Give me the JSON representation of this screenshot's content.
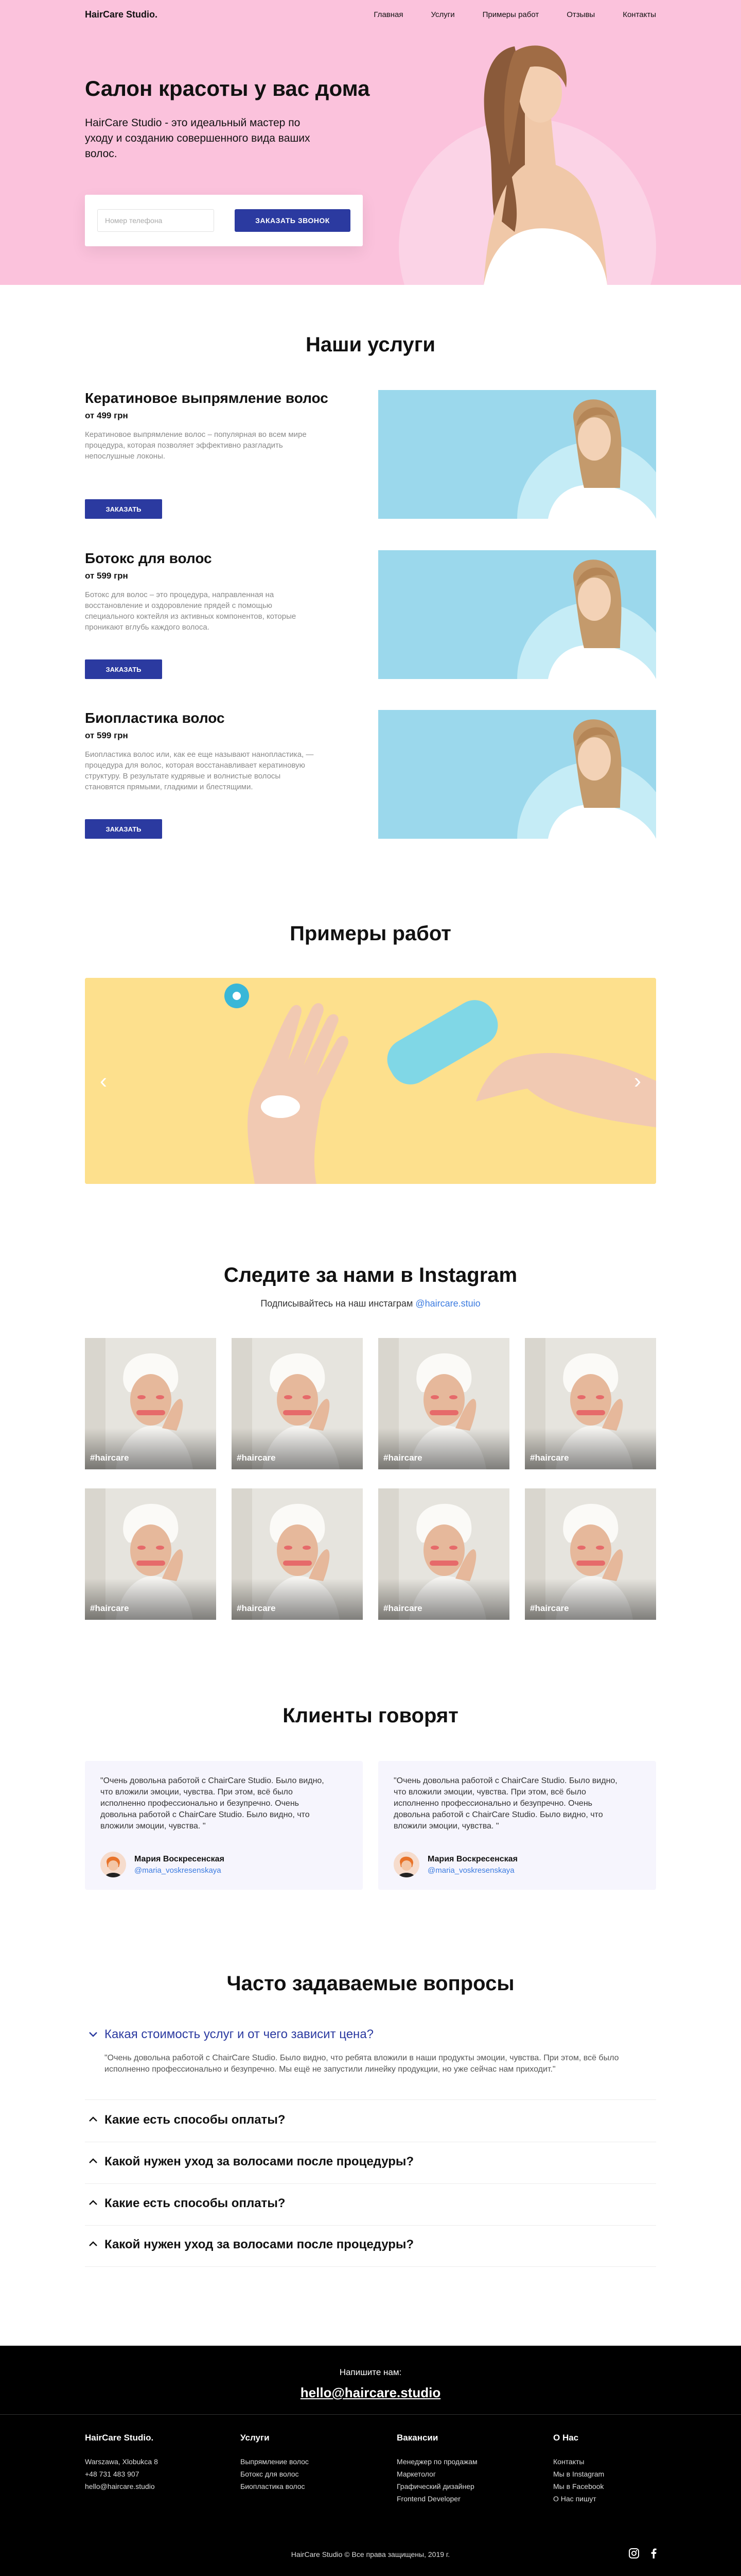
{
  "header": {
    "logo": "HairCare Studio.",
    "nav": [
      "Главная",
      "Услуги",
      "Примеры работ",
      "Отзывы",
      "Контакты"
    ]
  },
  "hero": {
    "title": "Салон красоты у вас дома",
    "subtitle": "HairCare Studio - это идеальный мастер по уходу и созданию совершенного вида ваших волос.",
    "phone_placeholder": "Номер телефона",
    "cta_label": "ЗАКАЗАТЬ ЗВОНОК"
  },
  "services": {
    "title": "Наши услуги",
    "items": [
      {
        "name": "Кератиновое выпрямление волос",
        "price": "от 499 грн",
        "desc": "Кератиновое выпрямление волос – популярная во всем мире процедура, которая позволяет эффективно разгладить непослушные локоны.",
        "button": "ЗАКАЗАТЬ"
      },
      {
        "name": "Ботокс для волос",
        "price": "от 599 грн",
        "desc": "Ботокс для волос – это процедура, направленная на восстановление и оздоровление прядей с помощью специального коктейля из активных компонентов, которые проникают вглубь каждого волоса.",
        "button": "ЗАКАЗАТЬ"
      },
      {
        "name": "Биопластика волос",
        "price": "от 599 грн",
        "desc": "Биопластика волос или, как ее еще называют нанопластика, — процедура для волос, которая восстанавливает кератиновую структуру. В результате кудрявые и волнистые волосы становятся прямыми, гладкими и блестящими.",
        "button": "ЗАКАЗАТЬ"
      }
    ]
  },
  "works": {
    "title": "Примеры работ",
    "prev_icon": "chevron-left-icon",
    "next_icon": "chevron-right-icon"
  },
  "instagram": {
    "title": "Следите за нами в Instagram",
    "subtitle": "Подписывайтесь на наш инстаграм",
    "handle": "@haircare.stuio",
    "tiles": [
      "#haircare",
      "#haircare",
      "#haircare",
      "#haircare",
      "#haircare",
      "#haircare",
      "#haircare",
      "#haircare"
    ]
  },
  "reviews": {
    "title": "Клиенты говорят",
    "items": [
      {
        "text": "\"Очень довольна работой с ChairCare Studio. Было видно, что вложили  эмоции, чувства. При этом, всё было исполненно профессионально и безупречно. Очень довольна работой с ChairCare Studio. Было видно, что вложили  эмоции, чувства. \"",
        "name": "Мария Воскресенская",
        "handle": "@maria_voskresenskaya"
      },
      {
        "text": "\"Очень довольна работой с ChairCare Studio. Было видно, что вложили  эмоции, чувства. При этом, всё было исполненно профессионально и безупречно. Очень довольна работой с ChairCare Studio. Было видно, что вложили  эмоции, чувства. \"",
        "name": "Мария Воскресенская",
        "handle": "@maria_voskresenskaya"
      }
    ]
  },
  "faq": {
    "title": "Часто задаваемые вопросы",
    "items": [
      {
        "q": "Какая стоимость услуг и от чего зависит цена?",
        "a": "\"Очень довольна работой с ChairCare Studio. Было видно, что ребята вложили в наши продукты эмоции, чувства. При этом, всё было исполненно профессионально и безупречно. Мы ещё не запустили линейку продукции, но уже сейчас нам приходит.\"",
        "open": true
      },
      {
        "q": "Какие есть способы оплаты?",
        "open": false
      },
      {
        "q": "Какой нужен уход за волосами после процедуры?",
        "open": false
      },
      {
        "q": "Какие есть способы оплаты?",
        "open": false
      },
      {
        "q": "Какой нужен уход за волосами после процедуры?",
        "open": false
      }
    ]
  },
  "footer": {
    "cta_label": "Напишите нам:",
    "email": "hello@haircare.studio",
    "columns": [
      {
        "title": "HairCare Studio.",
        "links": [
          "Warszawa, Xlobukca 8",
          "+48 731 483 907",
          "hello@haircare.studio"
        ]
      },
      {
        "title": "Услуги",
        "links": [
          "Выпрямление волос",
          "Ботокс для волос",
          "Биопластика волос"
        ]
      },
      {
        "title": "Вакансии",
        "links": [
          "Менеджер по продажам",
          "Маркетолог",
          "Графический дизайнер",
          "Frontend Developer"
        ]
      },
      {
        "title": "О Нас",
        "links": [
          "Контакты",
          "Мы в Instagram",
          "Мы в Facebook",
          "О Нас пишут"
        ]
      }
    ],
    "copyright": "HairCare Studio © Все права защищены, 2019 г.",
    "social": [
      "instagram-icon",
      "facebook-icon"
    ]
  },
  "colors": {
    "hero_bg": "#fbc2dc",
    "accent": "#2b3aa0",
    "service_img_bg": "#9bd8ec",
    "slider_bg": "#fde08d",
    "link": "#3b7be0",
    "footer_bg": "#000000"
  }
}
